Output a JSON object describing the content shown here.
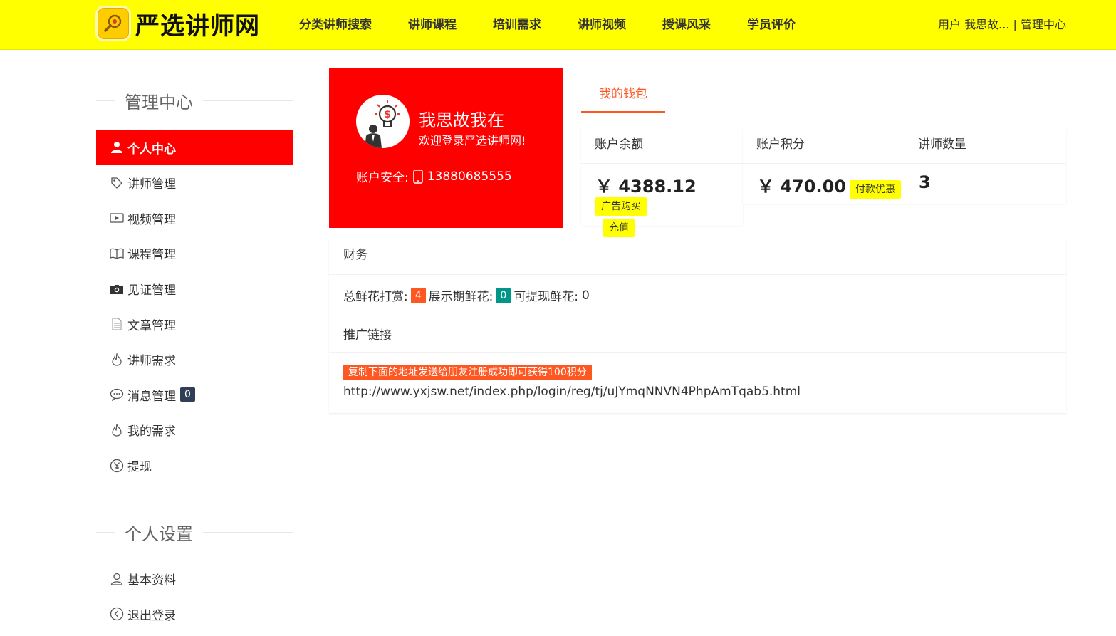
{
  "header": {
    "logo_text": "严选讲师网",
    "logo_icon": "magnifier-badge-icon",
    "nav": [
      "分类讲师搜索",
      "讲师课程",
      "培训需求",
      "讲师视频",
      "授课风采",
      "学员评价"
    ],
    "user_label": "用户",
    "user_name": "我思故...",
    "separator": "|",
    "admin_link": "管理中心"
  },
  "sidebar": {
    "section1_title": "管理中心",
    "items": [
      {
        "label": "个人中心",
        "icon": "user-icon",
        "active": true
      },
      {
        "label": "讲师管理",
        "icon": "tag-icon"
      },
      {
        "label": "视频管理",
        "icon": "video-icon"
      },
      {
        "label": "课程管理",
        "icon": "book-icon"
      },
      {
        "label": "见证管理",
        "icon": "camera-icon"
      },
      {
        "label": "文章管理",
        "icon": "document-icon"
      },
      {
        "label": "讲师需求",
        "icon": "fire-icon"
      },
      {
        "label": "消息管理",
        "icon": "chat-icon",
        "count": "0"
      },
      {
        "label": "我的需求",
        "icon": "fire-icon"
      },
      {
        "label": "提现",
        "icon": "yen-icon"
      }
    ],
    "section2_title": "个人设置",
    "settings": [
      {
        "label": "基本资料",
        "icon": "user-outline-icon"
      },
      {
        "label": "退出登录",
        "icon": "logout-icon"
      }
    ]
  },
  "profile": {
    "name": "我思故我在",
    "welcome": "欢迎登录严选讲师网!",
    "security_label": "账户安全:",
    "phone": "13880685555",
    "bg_color": "#ff0000"
  },
  "wallet": {
    "tab_label": "我的钱包",
    "balance_label": "账户余额",
    "balance_value": "￥ 4388.12",
    "balance_btn": "广告购买",
    "recharge_btn": "充值",
    "points_label": "账户积分",
    "points_value": "￥ 470.00",
    "points_btn": "付款优惠",
    "teachers_label": "讲师数量",
    "teachers_value": "3"
  },
  "finance": {
    "title": "财务",
    "total_flowers_label": "总鲜花打赏:",
    "total_flowers": "4",
    "display_flowers_label": "展示期鲜花:",
    "display_flowers": "0",
    "withdrawable_label": "可提现鲜花:",
    "withdrawable": "0",
    "promo_label": "推广链接",
    "promo_tip": "复制下面的地址发送给朋友注册成功即可获得100积分",
    "promo_url": "http://www.yxjsw.net/index.php/login/reg/tj/uJYmqNNVN4PhpAmTqab5.html"
  }
}
